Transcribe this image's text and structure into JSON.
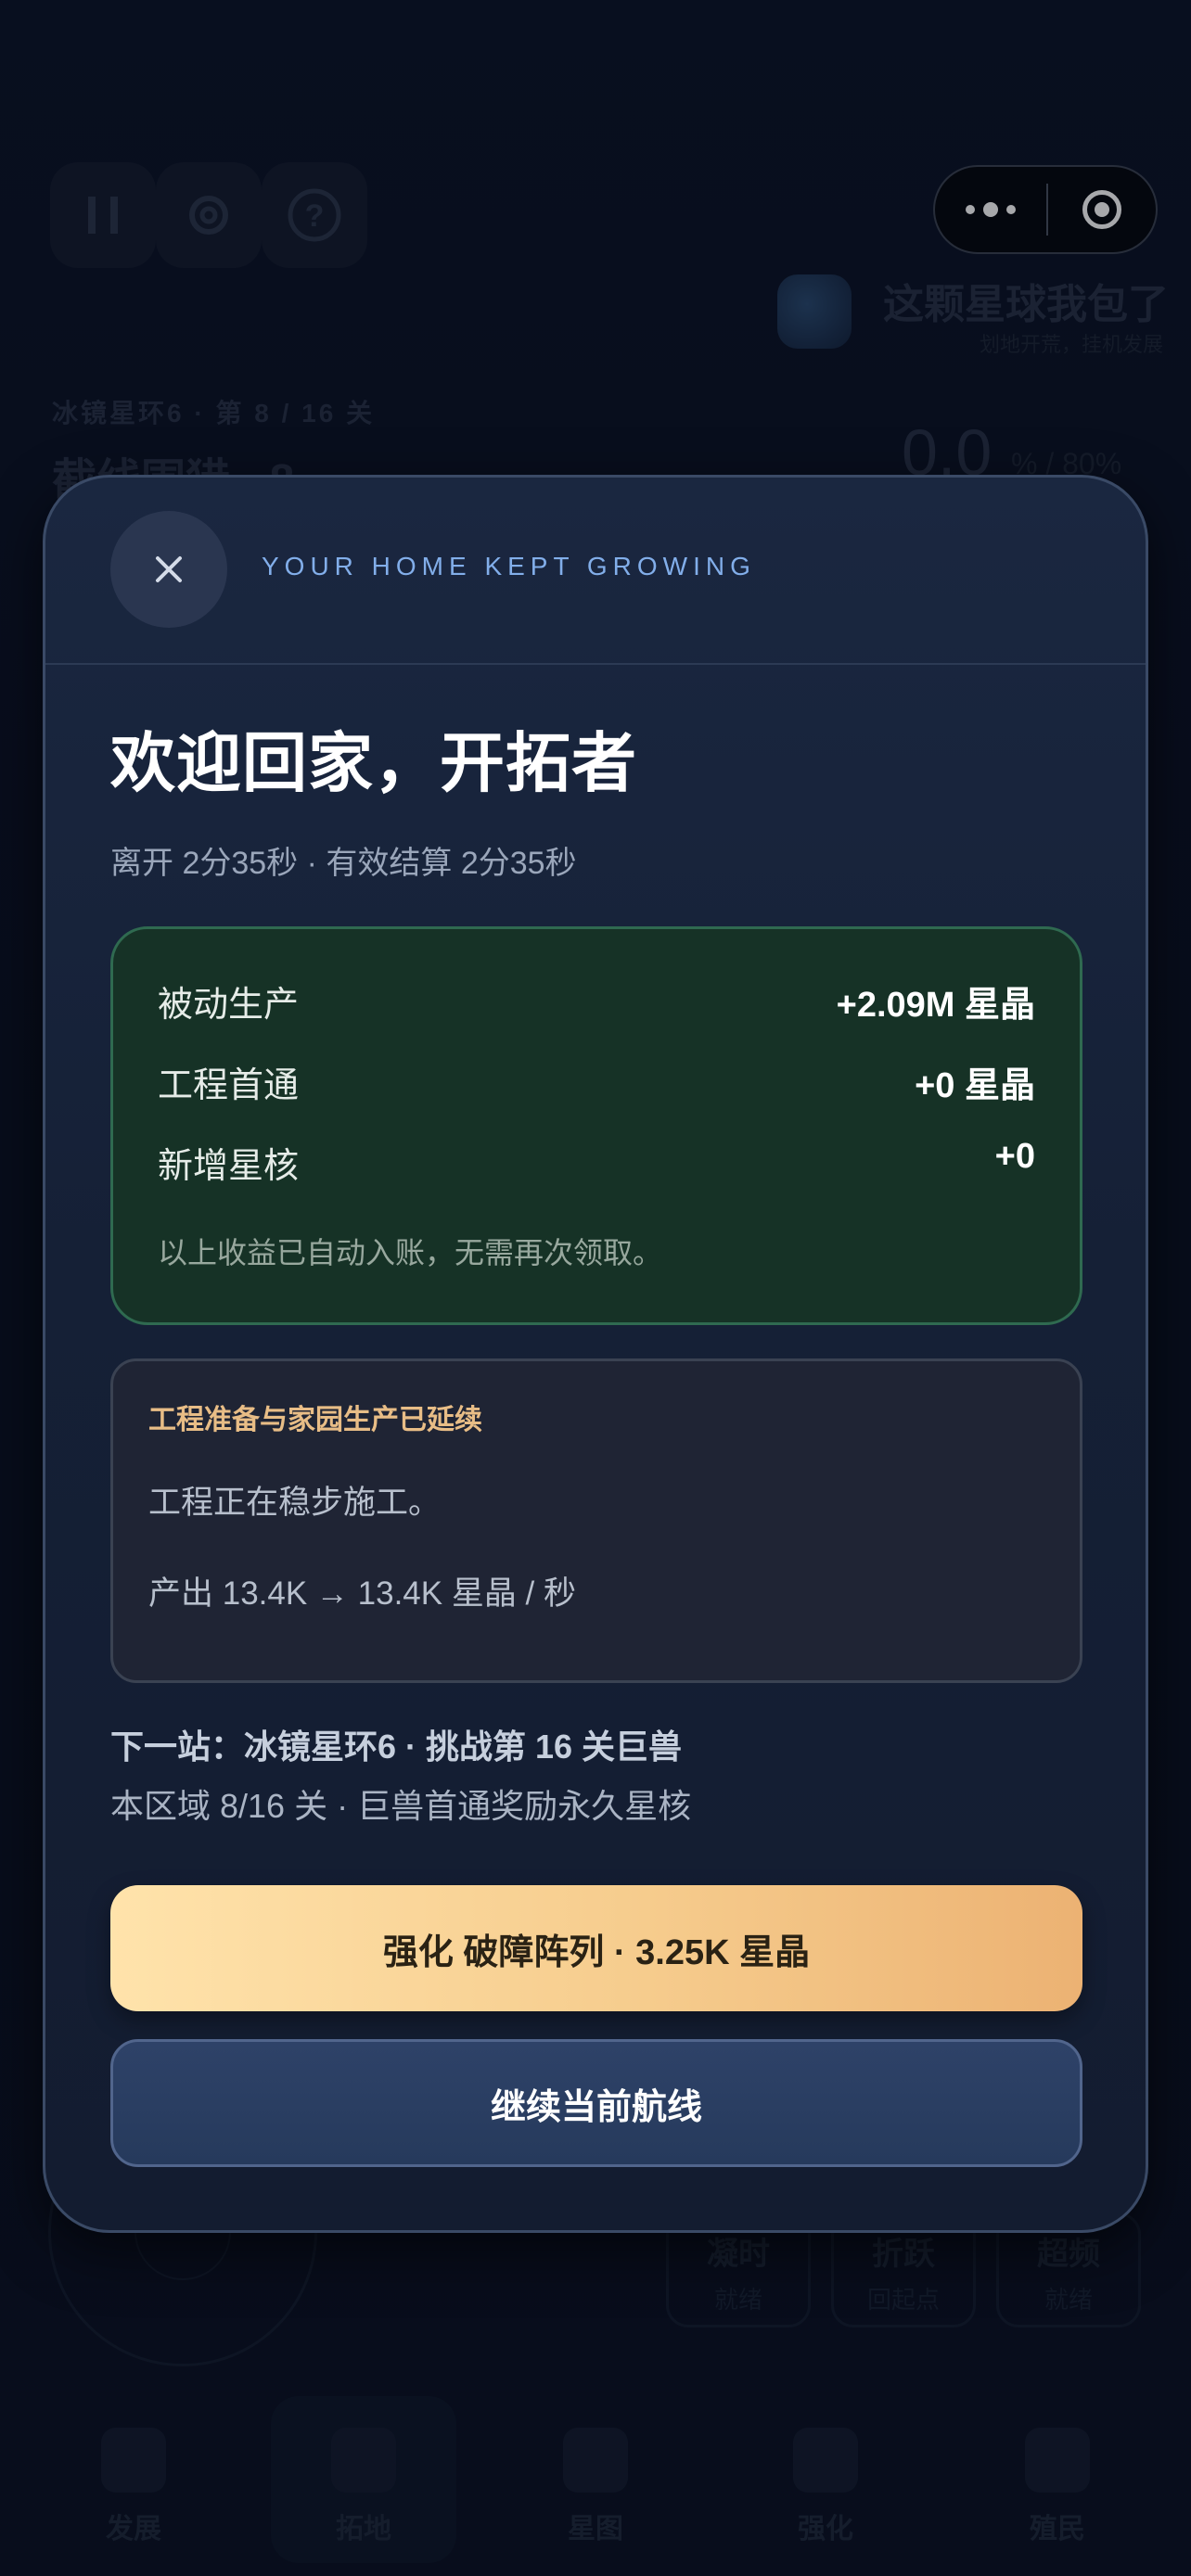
{
  "background": {
    "game_title": "这颗星球我包了",
    "game_tagline": "划地开荒，挂机发展",
    "region_line": "冰镜星环6 · 第 8 / 16 关",
    "stage_title": "截线围猎 · 8",
    "progress_value": "0.0",
    "progress_suffix": "% / 80%",
    "skills": [
      {
        "name": "凝时",
        "status": "就绪"
      },
      {
        "name": "折跃",
        "status": "回起点"
      },
      {
        "name": "超频",
        "status": "就绪"
      }
    ],
    "tabs": [
      {
        "label": "发展"
      },
      {
        "label": "拓地"
      },
      {
        "label": "星图"
      },
      {
        "label": "强化"
      },
      {
        "label": "殖民"
      }
    ],
    "icons": [
      "pause-icon",
      "settings-gear-icon",
      "help-icon",
      "more-dots-icon",
      "target-icon"
    ]
  },
  "modal": {
    "eyebrow": "YOUR HOME KEPT GROWING",
    "title": "欢迎回家，开拓者",
    "away_summary": "离开 2分35秒 · 有效结算 2分35秒",
    "earnings": [
      {
        "label": "被动生产",
        "value": "+2.09M 星晶"
      },
      {
        "label": "工程首通",
        "value": "+0 星晶"
      },
      {
        "label": "新增星核",
        "value": "+0"
      }
    ],
    "earnings_note": "以上收益已自动入账，无需再次领取。",
    "prep": {
      "title": "工程准备与家园生产已延续",
      "line1": "工程正在稳步施工。",
      "line2": "产出 13.4K → 13.4K 星晶 / 秒"
    },
    "next_stop": "下一站：冰镜星环6 · 挑战第 16 关巨兽",
    "region_reward": "本区域 8/16 关 · 巨兽首通奖励永久星核",
    "primary_button": "强化 破障阵列 · 3.25K 星晶",
    "secondary_button": "继续当前航线"
  },
  "colors": {
    "modal_bg": "#172339",
    "earn_card_bg": "#163226",
    "earn_card_border": "#2f6a50",
    "accent_gold": "#e8bd86",
    "eyebrow_blue": "#82aeea",
    "primary_gradient_start": "#ffe3ab",
    "primary_gradient_end": "#ecb273"
  }
}
